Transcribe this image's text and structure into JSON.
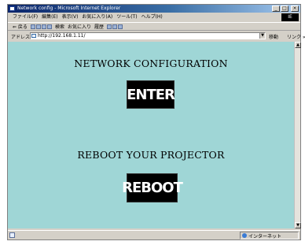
{
  "window": {
    "title": "Network config - Microsoft Internet Explorer",
    "min_label": "_",
    "max_label": "□",
    "close_label": "×"
  },
  "menubar": {
    "items": [
      "ファイル(F)",
      "編集(E)",
      "表示(V)",
      "お気に入り(A)",
      "ツール(T)",
      "ヘルプ(H)"
    ]
  },
  "toolbar": {
    "back_label": "⇐ 戻る",
    "search_label": "検索",
    "favorites_label": "お気に入り",
    "history_label": "履歴"
  },
  "addressbar": {
    "label": "アドレス(D)",
    "url": "http://192.168.1.11/",
    "go_label": "移動",
    "links_label": "リンク »"
  },
  "page": {
    "heading_network": "NETWORK CONFIGURATION",
    "enter_label": "ENTER",
    "heading_reboot": "REBOOT YOUR PROJECTOR",
    "reboot_label": "REBOOT"
  },
  "statusbar": {
    "zone_label": "インターネット"
  },
  "colors": {
    "page_background": "#9fd6d6",
    "button_background": "#000000",
    "button_text": "#ffffff"
  }
}
